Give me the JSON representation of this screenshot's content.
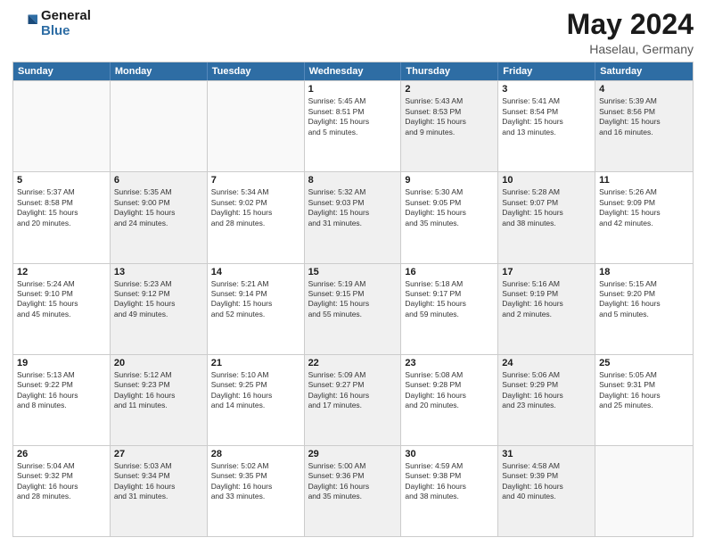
{
  "header": {
    "logo_general": "General",
    "logo_blue": "Blue",
    "main_title": "May 2024",
    "subtitle": "Haselau, Germany"
  },
  "weekdays": [
    "Sunday",
    "Monday",
    "Tuesday",
    "Wednesday",
    "Thursday",
    "Friday",
    "Saturday"
  ],
  "rows": [
    [
      {
        "day": "",
        "text": "",
        "shaded": false,
        "empty": true
      },
      {
        "day": "",
        "text": "",
        "shaded": false,
        "empty": true
      },
      {
        "day": "",
        "text": "",
        "shaded": false,
        "empty": true
      },
      {
        "day": "1",
        "text": "Sunrise: 5:45 AM\nSunset: 8:51 PM\nDaylight: 15 hours\nand 5 minutes.",
        "shaded": false,
        "empty": false
      },
      {
        "day": "2",
        "text": "Sunrise: 5:43 AM\nSunset: 8:53 PM\nDaylight: 15 hours\nand 9 minutes.",
        "shaded": true,
        "empty": false
      },
      {
        "day": "3",
        "text": "Sunrise: 5:41 AM\nSunset: 8:54 PM\nDaylight: 15 hours\nand 13 minutes.",
        "shaded": false,
        "empty": false
      },
      {
        "day": "4",
        "text": "Sunrise: 5:39 AM\nSunset: 8:56 PM\nDaylight: 15 hours\nand 16 minutes.",
        "shaded": true,
        "empty": false
      }
    ],
    [
      {
        "day": "5",
        "text": "Sunrise: 5:37 AM\nSunset: 8:58 PM\nDaylight: 15 hours\nand 20 minutes.",
        "shaded": false,
        "empty": false
      },
      {
        "day": "6",
        "text": "Sunrise: 5:35 AM\nSunset: 9:00 PM\nDaylight: 15 hours\nand 24 minutes.",
        "shaded": true,
        "empty": false
      },
      {
        "day": "7",
        "text": "Sunrise: 5:34 AM\nSunset: 9:02 PM\nDaylight: 15 hours\nand 28 minutes.",
        "shaded": false,
        "empty": false
      },
      {
        "day": "8",
        "text": "Sunrise: 5:32 AM\nSunset: 9:03 PM\nDaylight: 15 hours\nand 31 minutes.",
        "shaded": true,
        "empty": false
      },
      {
        "day": "9",
        "text": "Sunrise: 5:30 AM\nSunset: 9:05 PM\nDaylight: 15 hours\nand 35 minutes.",
        "shaded": false,
        "empty": false
      },
      {
        "day": "10",
        "text": "Sunrise: 5:28 AM\nSunset: 9:07 PM\nDaylight: 15 hours\nand 38 minutes.",
        "shaded": true,
        "empty": false
      },
      {
        "day": "11",
        "text": "Sunrise: 5:26 AM\nSunset: 9:09 PM\nDaylight: 15 hours\nand 42 minutes.",
        "shaded": false,
        "empty": false
      }
    ],
    [
      {
        "day": "12",
        "text": "Sunrise: 5:24 AM\nSunset: 9:10 PM\nDaylight: 15 hours\nand 45 minutes.",
        "shaded": false,
        "empty": false
      },
      {
        "day": "13",
        "text": "Sunrise: 5:23 AM\nSunset: 9:12 PM\nDaylight: 15 hours\nand 49 minutes.",
        "shaded": true,
        "empty": false
      },
      {
        "day": "14",
        "text": "Sunrise: 5:21 AM\nSunset: 9:14 PM\nDaylight: 15 hours\nand 52 minutes.",
        "shaded": false,
        "empty": false
      },
      {
        "day": "15",
        "text": "Sunrise: 5:19 AM\nSunset: 9:15 PM\nDaylight: 15 hours\nand 55 minutes.",
        "shaded": true,
        "empty": false
      },
      {
        "day": "16",
        "text": "Sunrise: 5:18 AM\nSunset: 9:17 PM\nDaylight: 15 hours\nand 59 minutes.",
        "shaded": false,
        "empty": false
      },
      {
        "day": "17",
        "text": "Sunrise: 5:16 AM\nSunset: 9:19 PM\nDaylight: 16 hours\nand 2 minutes.",
        "shaded": true,
        "empty": false
      },
      {
        "day": "18",
        "text": "Sunrise: 5:15 AM\nSunset: 9:20 PM\nDaylight: 16 hours\nand 5 minutes.",
        "shaded": false,
        "empty": false
      }
    ],
    [
      {
        "day": "19",
        "text": "Sunrise: 5:13 AM\nSunset: 9:22 PM\nDaylight: 16 hours\nand 8 minutes.",
        "shaded": false,
        "empty": false
      },
      {
        "day": "20",
        "text": "Sunrise: 5:12 AM\nSunset: 9:23 PM\nDaylight: 16 hours\nand 11 minutes.",
        "shaded": true,
        "empty": false
      },
      {
        "day": "21",
        "text": "Sunrise: 5:10 AM\nSunset: 9:25 PM\nDaylight: 16 hours\nand 14 minutes.",
        "shaded": false,
        "empty": false
      },
      {
        "day": "22",
        "text": "Sunrise: 5:09 AM\nSunset: 9:27 PM\nDaylight: 16 hours\nand 17 minutes.",
        "shaded": true,
        "empty": false
      },
      {
        "day": "23",
        "text": "Sunrise: 5:08 AM\nSunset: 9:28 PM\nDaylight: 16 hours\nand 20 minutes.",
        "shaded": false,
        "empty": false
      },
      {
        "day": "24",
        "text": "Sunrise: 5:06 AM\nSunset: 9:29 PM\nDaylight: 16 hours\nand 23 minutes.",
        "shaded": true,
        "empty": false
      },
      {
        "day": "25",
        "text": "Sunrise: 5:05 AM\nSunset: 9:31 PM\nDaylight: 16 hours\nand 25 minutes.",
        "shaded": false,
        "empty": false
      }
    ],
    [
      {
        "day": "26",
        "text": "Sunrise: 5:04 AM\nSunset: 9:32 PM\nDaylight: 16 hours\nand 28 minutes.",
        "shaded": false,
        "empty": false
      },
      {
        "day": "27",
        "text": "Sunrise: 5:03 AM\nSunset: 9:34 PM\nDaylight: 16 hours\nand 31 minutes.",
        "shaded": true,
        "empty": false
      },
      {
        "day": "28",
        "text": "Sunrise: 5:02 AM\nSunset: 9:35 PM\nDaylight: 16 hours\nand 33 minutes.",
        "shaded": false,
        "empty": false
      },
      {
        "day": "29",
        "text": "Sunrise: 5:00 AM\nSunset: 9:36 PM\nDaylight: 16 hours\nand 35 minutes.",
        "shaded": true,
        "empty": false
      },
      {
        "day": "30",
        "text": "Sunrise: 4:59 AM\nSunset: 9:38 PM\nDaylight: 16 hours\nand 38 minutes.",
        "shaded": false,
        "empty": false
      },
      {
        "day": "31",
        "text": "Sunrise: 4:58 AM\nSunset: 9:39 PM\nDaylight: 16 hours\nand 40 minutes.",
        "shaded": true,
        "empty": false
      },
      {
        "day": "",
        "text": "",
        "shaded": false,
        "empty": true
      }
    ]
  ]
}
